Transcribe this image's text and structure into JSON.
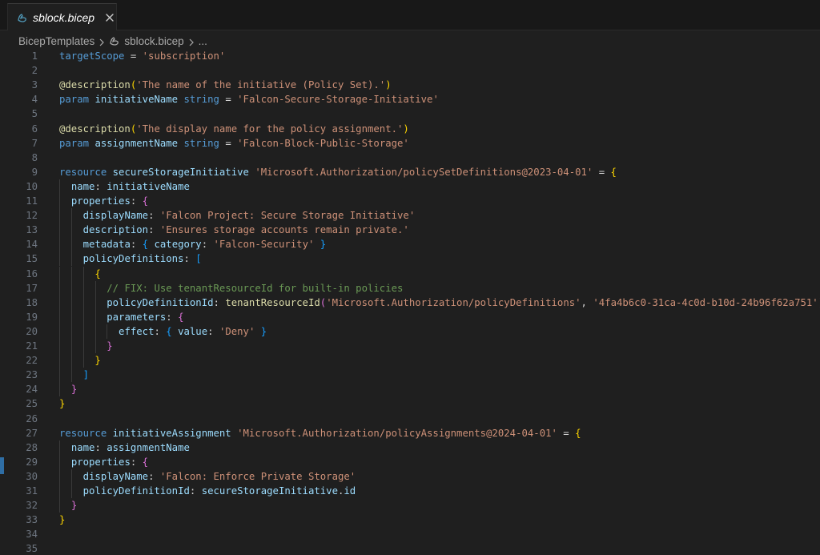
{
  "tab": {
    "label": "sblock.bicep",
    "icon": "bicep-file-icon",
    "close_icon": "close-icon"
  },
  "breadcrumb": {
    "folder": "BicepTemplates",
    "file": "sblock.bicep",
    "more": "..."
  },
  "editor": {
    "lines": [
      [
        [
          "kw",
          "targetScope"
        ],
        [
          "op",
          " = "
        ],
        [
          "str",
          "'subscription'"
        ]
      ],
      [],
      [
        [
          "fn",
          "@description"
        ],
        [
          "b1",
          "("
        ],
        [
          "str",
          "'The name of the initiative (Policy Set).'"
        ],
        [
          "b1",
          ")"
        ]
      ],
      [
        [
          "kw",
          "param"
        ],
        [
          "pl",
          " "
        ],
        [
          "id",
          "initiativeName"
        ],
        [
          "pl",
          " "
        ],
        [
          "kw",
          "string"
        ],
        [
          "op",
          " = "
        ],
        [
          "str",
          "'Falcon-Secure-Storage-Initiative'"
        ]
      ],
      [],
      [
        [
          "fn",
          "@description"
        ],
        [
          "b1",
          "("
        ],
        [
          "str",
          "'The display name for the policy assignment.'"
        ],
        [
          "b1",
          ")"
        ]
      ],
      [
        [
          "kw",
          "param"
        ],
        [
          "pl",
          " "
        ],
        [
          "id",
          "assignmentName"
        ],
        [
          "pl",
          " "
        ],
        [
          "kw",
          "string"
        ],
        [
          "op",
          " = "
        ],
        [
          "str",
          "'Falcon-Block-Public-Storage'"
        ]
      ],
      [],
      [
        [
          "kw",
          "resource"
        ],
        [
          "pl",
          " "
        ],
        [
          "id",
          "secureStorageInitiative"
        ],
        [
          "pl",
          " "
        ],
        [
          "str",
          "'Microsoft.Authorization/policySetDefinitions@2023-04-01'"
        ],
        [
          "op",
          " = "
        ],
        [
          "b1",
          "{"
        ]
      ],
      [
        [
          "pl",
          "  "
        ],
        [
          "id",
          "name"
        ],
        [
          "op",
          ": "
        ],
        [
          "id",
          "initiativeName"
        ]
      ],
      [
        [
          "pl",
          "  "
        ],
        [
          "id",
          "properties"
        ],
        [
          "op",
          ": "
        ],
        [
          "b2",
          "{"
        ]
      ],
      [
        [
          "pl",
          "    "
        ],
        [
          "id",
          "displayName"
        ],
        [
          "op",
          ": "
        ],
        [
          "str",
          "'Falcon Project: Secure Storage Initiative'"
        ]
      ],
      [
        [
          "pl",
          "    "
        ],
        [
          "id",
          "description"
        ],
        [
          "op",
          ": "
        ],
        [
          "str",
          "'Ensures storage accounts remain private.'"
        ]
      ],
      [
        [
          "pl",
          "    "
        ],
        [
          "id",
          "metadata"
        ],
        [
          "op",
          ": "
        ],
        [
          "b3",
          "{"
        ],
        [
          "pl",
          " "
        ],
        [
          "id",
          "category"
        ],
        [
          "op",
          ": "
        ],
        [
          "str",
          "'Falcon-Security'"
        ],
        [
          "pl",
          " "
        ],
        [
          "b3",
          "}"
        ]
      ],
      [
        [
          "pl",
          "    "
        ],
        [
          "id",
          "policyDefinitions"
        ],
        [
          "op",
          ": "
        ],
        [
          "b3",
          "["
        ]
      ],
      [
        [
          "pl",
          "      "
        ],
        [
          "b1",
          "{"
        ]
      ],
      [
        [
          "pl",
          "        "
        ],
        [
          "cm",
          "// FIX: Use tenantResourceId for built-in policies"
        ]
      ],
      [
        [
          "pl",
          "        "
        ],
        [
          "id",
          "policyDefinitionId"
        ],
        [
          "op",
          ": "
        ],
        [
          "fn",
          "tenantResourceId"
        ],
        [
          "b2",
          "("
        ],
        [
          "str",
          "'Microsoft.Authorization/policyDefinitions'"
        ],
        [
          "op",
          ", "
        ],
        [
          "str",
          "'4fa4b6c0-31ca-4c0d-b10d-24b96f62a751'"
        ],
        [
          "b2",
          ")"
        ]
      ],
      [
        [
          "pl",
          "        "
        ],
        [
          "id",
          "parameters"
        ],
        [
          "op",
          ": "
        ],
        [
          "b2",
          "{"
        ]
      ],
      [
        [
          "pl",
          "          "
        ],
        [
          "id",
          "effect"
        ],
        [
          "op",
          ": "
        ],
        [
          "b3",
          "{"
        ],
        [
          "pl",
          " "
        ],
        [
          "id",
          "value"
        ],
        [
          "op",
          ": "
        ],
        [
          "str",
          "'Deny'"
        ],
        [
          "pl",
          " "
        ],
        [
          "b3",
          "}"
        ]
      ],
      [
        [
          "pl",
          "        "
        ],
        [
          "b2",
          "}"
        ]
      ],
      [
        [
          "pl",
          "      "
        ],
        [
          "b1",
          "}"
        ]
      ],
      [
        [
          "pl",
          "    "
        ],
        [
          "b3",
          "]"
        ]
      ],
      [
        [
          "pl",
          "  "
        ],
        [
          "b2",
          "}"
        ]
      ],
      [
        [
          "b1",
          "}"
        ]
      ],
      [],
      [
        [
          "kw",
          "resource"
        ],
        [
          "pl",
          " "
        ],
        [
          "id",
          "initiativeAssignment"
        ],
        [
          "pl",
          " "
        ],
        [
          "str",
          "'Microsoft.Authorization/policyAssignments@2024-04-01'"
        ],
        [
          "op",
          " = "
        ],
        [
          "b1",
          "{"
        ]
      ],
      [
        [
          "pl",
          "  "
        ],
        [
          "id",
          "name"
        ],
        [
          "op",
          ": "
        ],
        [
          "id",
          "assignmentName"
        ]
      ],
      [
        [
          "pl",
          "  "
        ],
        [
          "id",
          "properties"
        ],
        [
          "op",
          ": "
        ],
        [
          "b2",
          "{"
        ]
      ],
      [
        [
          "pl",
          "    "
        ],
        [
          "id",
          "displayName"
        ],
        [
          "op",
          ": "
        ],
        [
          "str",
          "'Falcon: Enforce Private Storage'"
        ]
      ],
      [
        [
          "pl",
          "    "
        ],
        [
          "id",
          "policyDefinitionId"
        ],
        [
          "op",
          ": "
        ],
        [
          "id",
          "secureStorageInitiative"
        ],
        [
          "op",
          "."
        ],
        [
          "id",
          "id"
        ]
      ],
      [
        [
          "pl",
          "  "
        ],
        [
          "b2",
          "}"
        ]
      ],
      [
        [
          "b1",
          "}"
        ]
      ],
      [],
      []
    ],
    "indent_levels": [
      0,
      0,
      0,
      0,
      0,
      0,
      0,
      0,
      0,
      1,
      1,
      2,
      2,
      2,
      2,
      3,
      4,
      4,
      4,
      5,
      4,
      3,
      2,
      1,
      0,
      0,
      0,
      1,
      1,
      2,
      2,
      1,
      0,
      0,
      0
    ]
  }
}
